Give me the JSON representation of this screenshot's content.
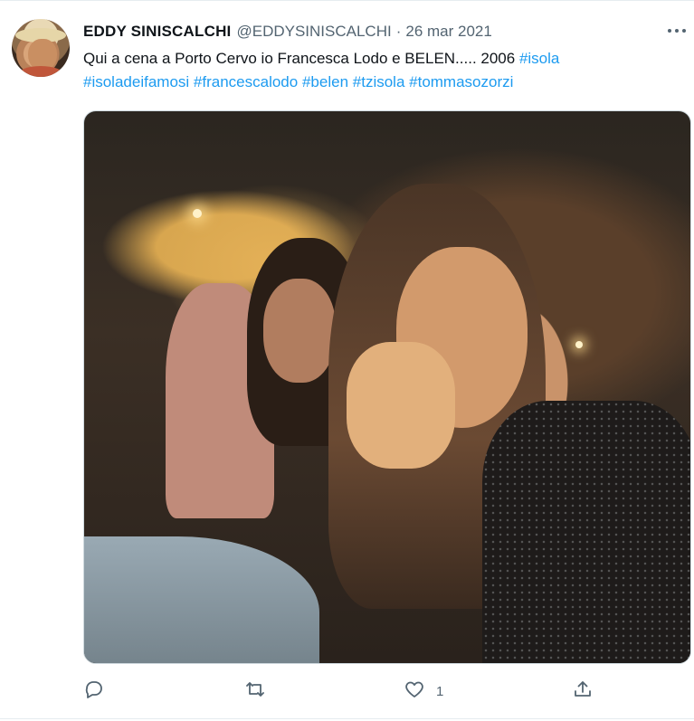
{
  "tweet": {
    "author_name": "EDDY SINISCALCHI",
    "handle": "@EDDYSINISCALCHI",
    "separator": "·",
    "date": "26 mar 2021",
    "more_icon": "more-horizontal-icon",
    "text_line1": "Qui a cena a Porto Cervo io Francesca Lodo e BELEN..... 2006",
    "hashtags_line1": [
      "#isola"
    ],
    "hashtags_line2": [
      "#isoladeifamosi",
      "#francescalodo",
      "#belen",
      "#tzisola",
      "#tommasozorzi"
    ],
    "hashtag_color": "#1d9bf0"
  },
  "actions": {
    "reply_icon": "reply-icon",
    "retweet_icon": "retweet-icon",
    "like_icon": "heart-icon",
    "like_count": "1",
    "share_icon": "share-icon"
  }
}
